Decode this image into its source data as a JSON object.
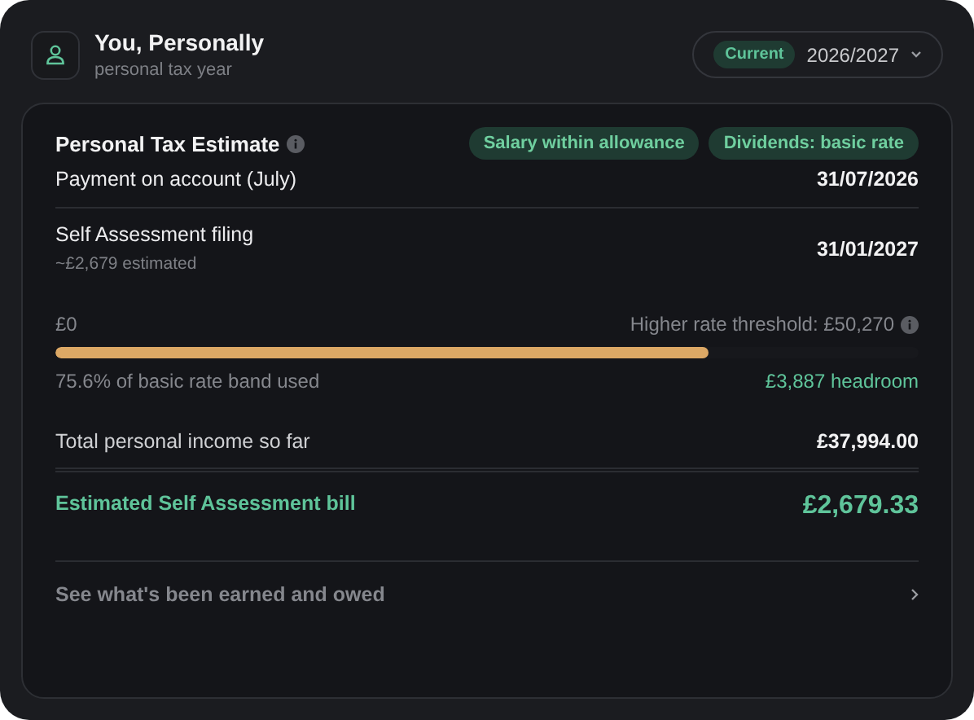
{
  "header": {
    "title": "You, Personally",
    "subtitle": "personal tax year",
    "year_selector": {
      "badge": "Current",
      "value": "2026/2027"
    }
  },
  "card": {
    "title": "Personal Tax Estimate",
    "tags": [
      "Salary within allowance",
      "Dividends: basic rate"
    ],
    "deadlines": [
      {
        "label": "Payment on account (July)",
        "date": "31/07/2026"
      },
      {
        "label": "Self Assessment filing",
        "note": "~£2,679 estimated",
        "date": "31/01/2027"
      }
    ],
    "band": {
      "start": "£0",
      "threshold": "Higher rate threshold: £50,270",
      "level": 0.756,
      "used": "75.6% of basic rate band used",
      "headroom": "£3,887 headroom"
    },
    "income": {
      "label": "Total personal income so far",
      "value": "£37,994.00"
    },
    "bill": {
      "label": "Estimated Self Assessment bill",
      "value": "£2,679.33"
    },
    "link": "See what's been earned and owed"
  }
}
